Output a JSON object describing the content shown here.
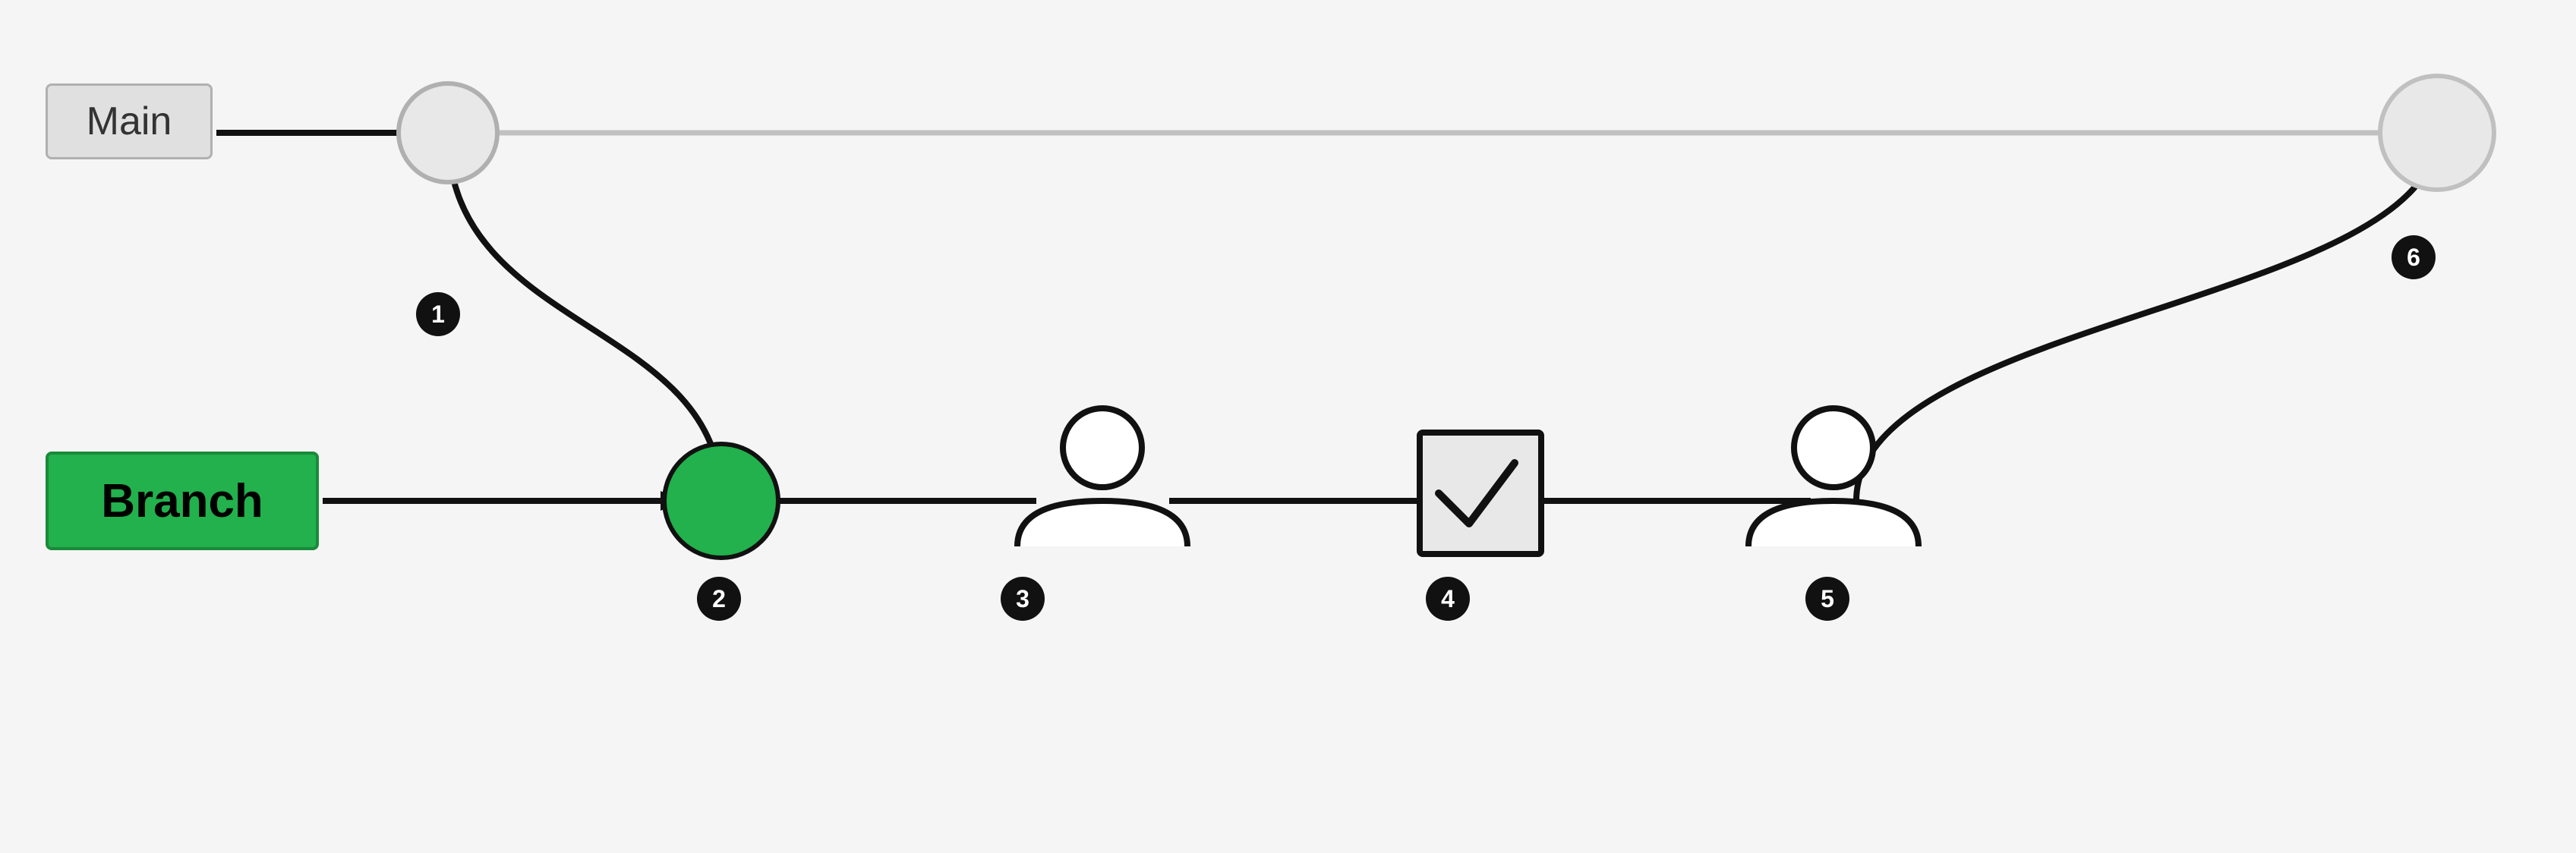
{
  "labels": {
    "main": "Main",
    "branch": "Branch"
  },
  "badges": [
    {
      "id": 1,
      "label": "1"
    },
    {
      "id": 2,
      "label": "2"
    },
    {
      "id": 3,
      "label": "3"
    },
    {
      "id": 4,
      "label": "4"
    },
    {
      "id": 5,
      "label": "5"
    },
    {
      "id": 6,
      "label": "6"
    }
  ],
  "colors": {
    "background": "#f5f5f5",
    "main_box_bg": "#e0e0e0",
    "main_box_border": "#b0b0b0",
    "branch_box_bg": "#22b14c",
    "branch_box_border": "#1a8a3a",
    "circle_main_fill": "#e0e0e0",
    "circle_main_stroke": "#c0c0c0",
    "circle_branch_fill": "#22b14c",
    "circle_branch_stroke": "#111",
    "person_stroke": "#111",
    "checkbox_stroke": "#111",
    "line_main": "#c0c0c0",
    "line_branch": "#111",
    "badge_bg": "#111",
    "badge_text": "#fff",
    "arrow_color": "#111"
  }
}
